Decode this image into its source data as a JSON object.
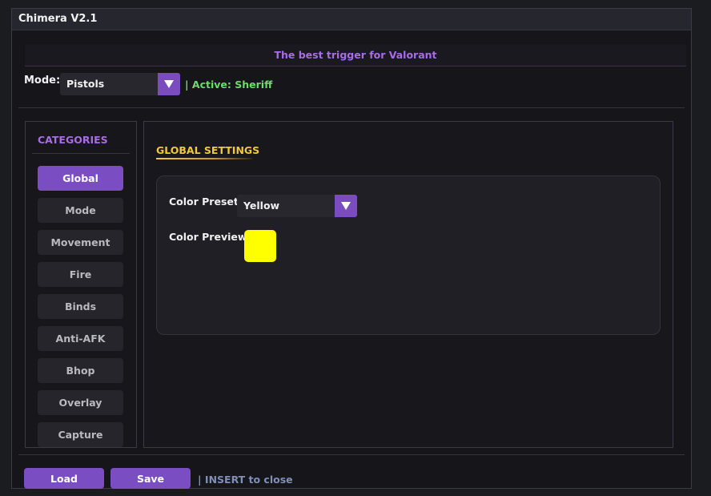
{
  "window": {
    "title": "Chimera V2.1"
  },
  "banner": {
    "tagline": "The best trigger for Valorant"
  },
  "mode": {
    "label": "Mode:",
    "selected": "Pistols",
    "active_status": "| Active: Sheriff"
  },
  "sidebar": {
    "title": "CATEGORIES",
    "items": [
      {
        "label": "Global",
        "active": true
      },
      {
        "label": "Mode",
        "active": false
      },
      {
        "label": "Movement",
        "active": false
      },
      {
        "label": "Fire",
        "active": false
      },
      {
        "label": "Binds",
        "active": false
      },
      {
        "label": "Anti-AFK",
        "active": false
      },
      {
        "label": "Bhop",
        "active": false
      },
      {
        "label": "Overlay",
        "active": false
      },
      {
        "label": "Capture",
        "active": false
      }
    ]
  },
  "global_settings": {
    "title": "GLOBAL SETTINGS",
    "color_preset_label": "Color Preset:",
    "color_preset_value": "Yellow",
    "color_preview_label": "Color Preview:",
    "preview_color": "#ffff00"
  },
  "footer": {
    "load_label": "Load",
    "save_label": "Save",
    "hint": "| INSERT to close"
  },
  "colors": {
    "accent": "#7b4dc3",
    "tagline": "#a76de6",
    "active_status": "#6edb6e",
    "section_title": "#f0c93a",
    "hint": "#7f8fb8"
  },
  "icons": {
    "dropdown_arrow": "triangle-down-icon"
  }
}
